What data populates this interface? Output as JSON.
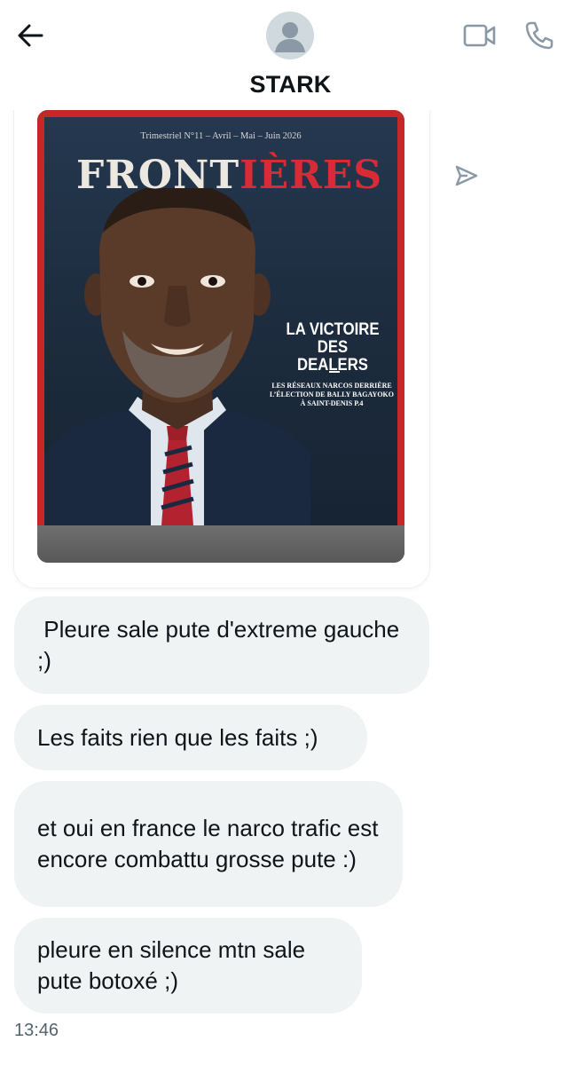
{
  "header": {
    "back_icon": "arrow-left-icon",
    "contact_name": "STARK",
    "avatar_icon": "default-avatar-icon",
    "video_icon": "video-camera-icon",
    "call_icon": "phone-icon"
  },
  "shared_post": {
    "magazine": {
      "issue_line": "Trimestriel N°11 – Avril – Mai – Juin 2026",
      "title_part1": "FRONT",
      "title_part2": "IÈRES",
      "headline": "LA VICTOIRE DES DEALERS",
      "subheadline": "LES RÉSEAUX NARCOS DERRIÈRE L’ÉLECTION DE BALLY BAGAYOKO À SAINT-DENIS P.4"
    },
    "share_icon": "send-icon"
  },
  "messages": [
    {
      "text": " Pleure sale pute d'extreme gauche ;)"
    },
    {
      "text": "Les faits rien que les faits ;)"
    },
    {
      "text": "et oui en france le narco trafic est encore combattu grosse pute :)"
    },
    {
      "text": "pleure en silence mtn sale pute botoxé ;)"
    }
  ],
  "timestamp": "13:46",
  "colors": {
    "bubble_bg": "#eff3f4",
    "text_primary": "#0f1419",
    "text_secondary": "#536471",
    "icon_gray": "#8b98a5",
    "magazine_red": "#d82b35"
  }
}
